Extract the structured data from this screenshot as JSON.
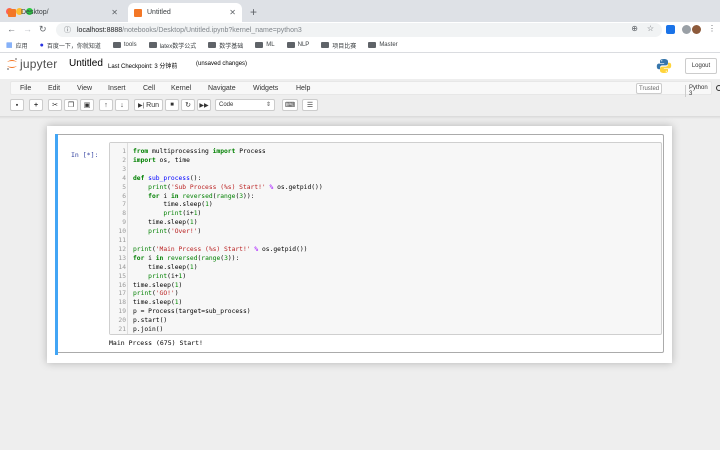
{
  "browser": {
    "tabs": [
      {
        "title": "Desktop/",
        "active": false
      },
      {
        "title": "Untitled",
        "active": true
      }
    ],
    "new_tab": "+",
    "address": {
      "host": "localhost:8888",
      "path": "/notebooks/Desktop/Untitled.ipynb?kernel_name=python3"
    },
    "bookmarks": [
      "应用",
      "百度一下，你就知道",
      "tools",
      "latex数学公式",
      "数学基础",
      "ML",
      "NLP",
      "项目比赛",
      "Master"
    ]
  },
  "jupyter": {
    "logo_text": "jupyter",
    "notebook_name": "Untitled",
    "checkpoint": "Last Checkpoint: 3 分钟前",
    "unsaved": "(unsaved changes)",
    "logout_label": "Logout",
    "menu": [
      "File",
      "Edit",
      "View",
      "Insert",
      "Cell",
      "Kernel",
      "Navigate",
      "Widgets",
      "Help"
    ],
    "trusted": "Trusted",
    "kernel": "Python 3",
    "run_label": "Run",
    "cell_type": "Code"
  },
  "cell": {
    "prompt": "In [*]:",
    "lines": [
      "from multiprocessing import Process",
      "import os, time",
      "",
      "def sub_process():",
      "    print('Sub Process (%s) Start!' % os.getpid())",
      "    for i in reversed(range(3)):",
      "        time.sleep(1)",
      "        print(i+1)",
      "    time.sleep(1)",
      "    print('Over!')",
      "",
      "print('Main Prcess (%s) Start!' % os.getpid())",
      "for i in reversed(range(3)):",
      "    time.sleep(1)",
      "    print(i+1)",
      "time.sleep(1)",
      "print('GO!')",
      "time.sleep(1)",
      "p = Process(target=sub_process)",
      "p.start()",
      "p.join()"
    ],
    "output": "Main Prcess (675) Start!"
  }
}
